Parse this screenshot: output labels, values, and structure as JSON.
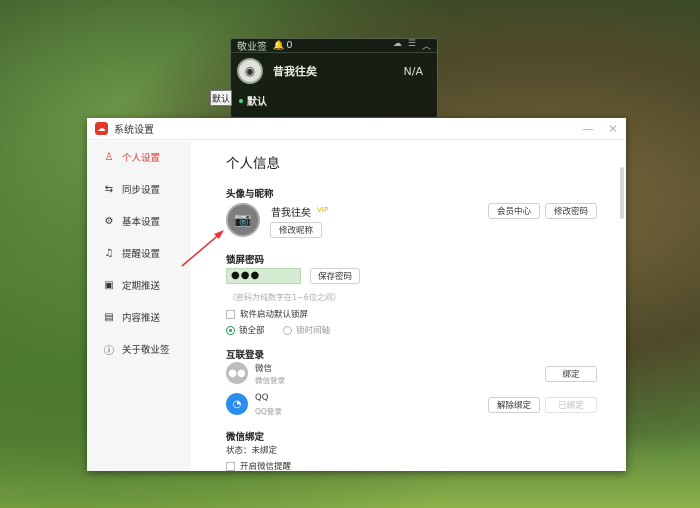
{
  "widget": {
    "title": "敬业签",
    "notify_count": "0",
    "user_name": "昔我往矣",
    "status": "N/A",
    "group": "默认"
  },
  "desktop": {
    "mini_label": "默认"
  },
  "window": {
    "title": "系统设置",
    "sidebar": [
      {
        "label": "个人设置",
        "icon": "person-icon"
      },
      {
        "label": "同步设置",
        "icon": "sync-icon"
      },
      {
        "label": "基本设置",
        "icon": "gear-icon"
      },
      {
        "label": "提醒设置",
        "icon": "bell-icon"
      },
      {
        "label": "定期推送",
        "icon": "schedule-icon"
      },
      {
        "label": "内容推送",
        "icon": "content-icon"
      },
      {
        "label": "关于敬业签",
        "icon": "info-icon"
      }
    ],
    "active_index": 0
  },
  "content": {
    "page_title": "个人信息",
    "avatar_section": {
      "heading": "头像与昵称",
      "nickname": "昔我往矣",
      "vip": "VIP",
      "edit_nickname": "修改昵称",
      "member_center": "会员中心",
      "change_password": "修改密码"
    },
    "lock_section": {
      "heading": "锁屏密码",
      "password_value": "●●●",
      "save_button": "保存密码",
      "hint": "（密码为纯数字在1~6位之间）",
      "auto_lock_label": "软件启动默认锁屏",
      "radio_all": "锁全部",
      "radio_timeline": "锁时间轴"
    },
    "linked_section": {
      "heading": "互联登录",
      "wechat_name": "微信",
      "wechat_sub": "微信登录",
      "wechat_bind": "绑定",
      "qq_name": "QQ",
      "qq_sub": "QQ登录",
      "qq_unbind": "解除绑定",
      "qq_bound": "已绑定"
    },
    "wechat_bind_section": {
      "heading": "微信绑定",
      "status": "状态：未绑定",
      "reminder_label": "开启微信提醒"
    }
  },
  "colors": {
    "accent": "#e2382c",
    "radio_green": "#1fa35b",
    "password_bg": "#d5ecd2"
  }
}
